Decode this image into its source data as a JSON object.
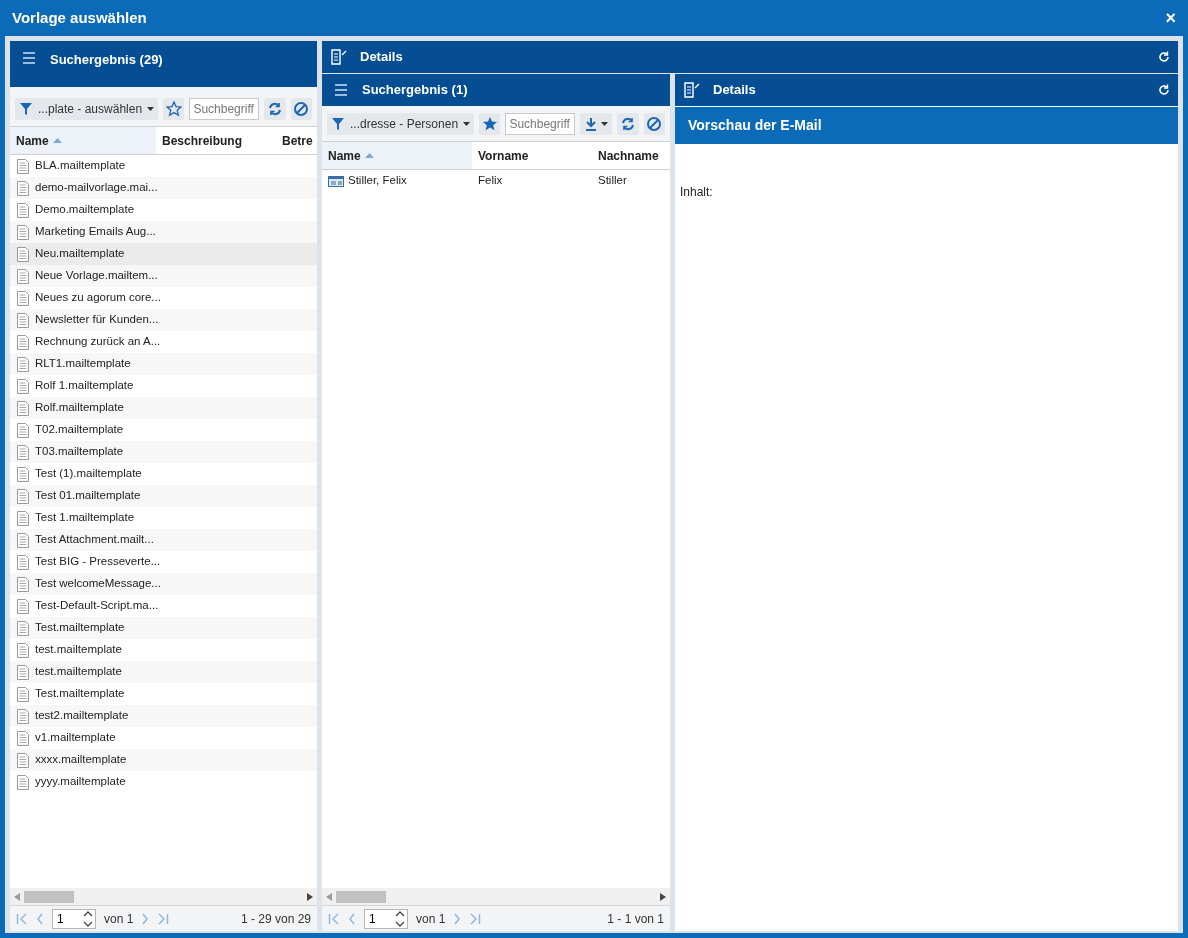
{
  "window": {
    "title": "Vorlage auswählen",
    "close": "×"
  },
  "left": {
    "title": "Suchergebnis (29)",
    "filter": "...plate - auswählen",
    "search_placeholder": "Suchbegriff",
    "columns": [
      {
        "label": "Name",
        "sorted": true
      },
      {
        "label": "Beschreibung",
        "sorted": false
      },
      {
        "label": "Betre",
        "sorted": false
      }
    ],
    "rows": [
      {
        "name": "BLA.mailtemplate",
        "hovered": false
      },
      {
        "name": "demo-mailvorlage.mai...",
        "hovered": false
      },
      {
        "name": "Demo.mailtemplate",
        "hovered": false
      },
      {
        "name": "Marketing Emails Aug...",
        "hovered": false
      },
      {
        "name": "Neu.mailtemplate",
        "hovered": true
      },
      {
        "name": "Neue Vorlage.mailtem...",
        "hovered": false
      },
      {
        "name": "Neues zu agorum core...",
        "hovered": false
      },
      {
        "name": "Newsletter für Kunden...",
        "hovered": false
      },
      {
        "name": "Rechnung zurück an A...",
        "hovered": false
      },
      {
        "name": "RLT1.mailtemplate",
        "hovered": false
      },
      {
        "name": "Rolf 1.mailtemplate",
        "hovered": false
      },
      {
        "name": "Rolf.mailtemplate",
        "hovered": false
      },
      {
        "name": "T02.mailtemplate",
        "hovered": false
      },
      {
        "name": "T03.mailtemplate",
        "hovered": false
      },
      {
        "name": "Test (1).mailtemplate",
        "hovered": false
      },
      {
        "name": "Test 01.mailtemplate",
        "hovered": false
      },
      {
        "name": "Test 1.mailtemplate",
        "hovered": false
      },
      {
        "name": "Test Attachment.mailt...",
        "hovered": false
      },
      {
        "name": "Test BIG - Presseverte...",
        "hovered": false
      },
      {
        "name": "Test welcomeMessage...",
        "hovered": false
      },
      {
        "name": "Test-Default-Script.ma...",
        "hovered": false
      },
      {
        "name": "Test.mailtemplate",
        "hovered": false
      },
      {
        "name": "test.mailtemplate",
        "hovered": false
      },
      {
        "name": "test.mailtemplate",
        "hovered": false
      },
      {
        "name": "Test.mailtemplate",
        "hovered": false
      },
      {
        "name": "test2.mailtemplate",
        "hovered": false
      },
      {
        "name": "v1.mailtemplate",
        "hovered": false
      },
      {
        "name": "xxxx.mailtemplate",
        "hovered": false
      },
      {
        "name": "yyyy.mailtemplate",
        "hovered": false
      }
    ],
    "paging": {
      "page": "1",
      "of": "von 1",
      "summary": "1 - 29 von 29"
    }
  },
  "details": {
    "title": "Details",
    "middle": {
      "title": "Suchergebnis (1)",
      "filter": "...dresse - Personen",
      "search_placeholder": "Suchbegriff",
      "columns": [
        {
          "label": "Name",
          "sorted": true
        },
        {
          "label": "Vorname",
          "sorted": false
        },
        {
          "label": "Nachname",
          "sorted": false
        }
      ],
      "rows": [
        {
          "cells": [
            "Stiller, Felix",
            "Felix",
            "Stiller"
          ]
        }
      ],
      "paging": {
        "page": "1",
        "of": "von 1",
        "summary": "1 - 1 von 1"
      }
    },
    "right": {
      "title": "Details",
      "preview_title": "Vorschau der E-Mail",
      "content_label": "Inhalt:"
    }
  }
}
